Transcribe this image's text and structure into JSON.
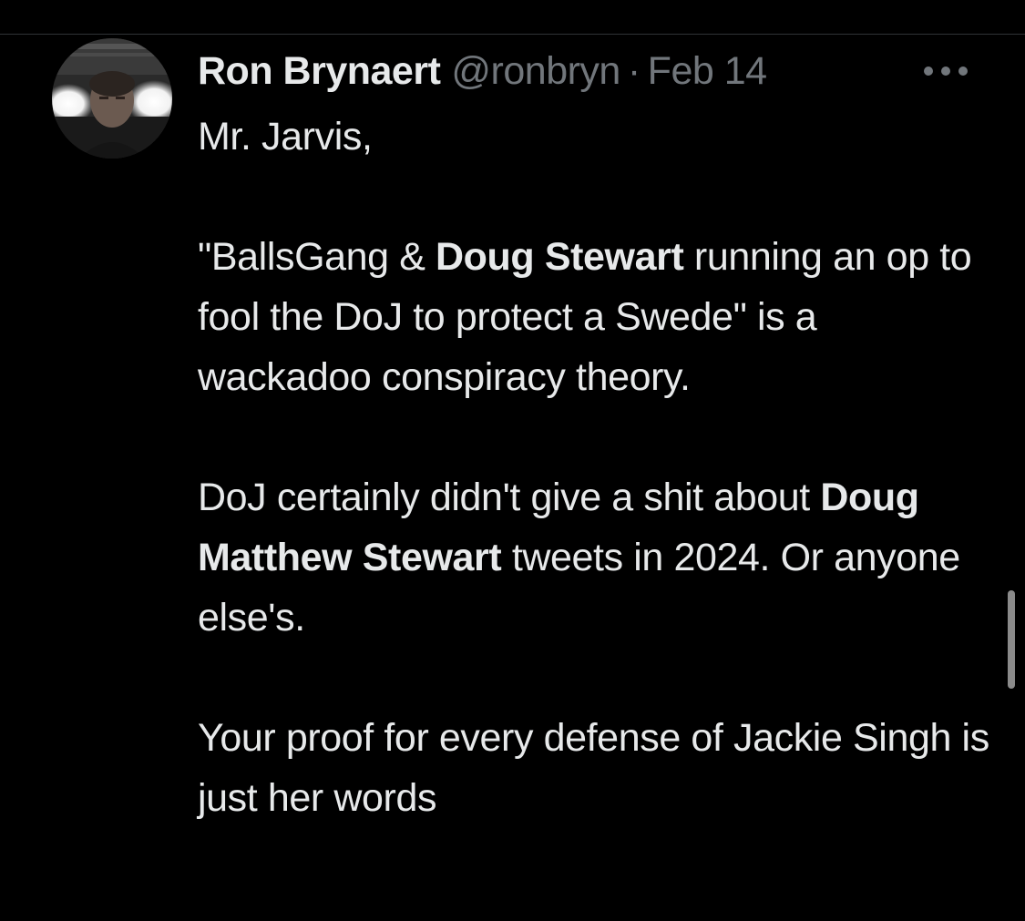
{
  "tweet": {
    "author": {
      "display_name": "Ron Brynaert",
      "handle": "@ronbryn"
    },
    "separator": "·",
    "date": "Feb 14",
    "more_icon": "ellipsis-horizontal-icon",
    "body": {
      "greeting": "Mr. Jarvis,",
      "p2_part1": "\"BallsGang & ",
      "p2_bold1": "Doug Stewart",
      "p2_part2": " running an op to fool the DoJ to protect a Swede\" is a wackadoo conspiracy theory.",
      "p3_part1": "DoJ certainly didn't give a shit about ",
      "p3_bold1": "Doug Matthew Stewart",
      "p3_part2": " tweets in 2024. Or anyone else's.",
      "p4": "Your proof for every defense of Jackie Singh is just her words"
    }
  },
  "colors": {
    "background": "#000000",
    "primary_text": "#e7e9ea",
    "secondary_text": "#71767b",
    "divider": "#2f3336",
    "scrollbar": "#8b8b8b"
  }
}
